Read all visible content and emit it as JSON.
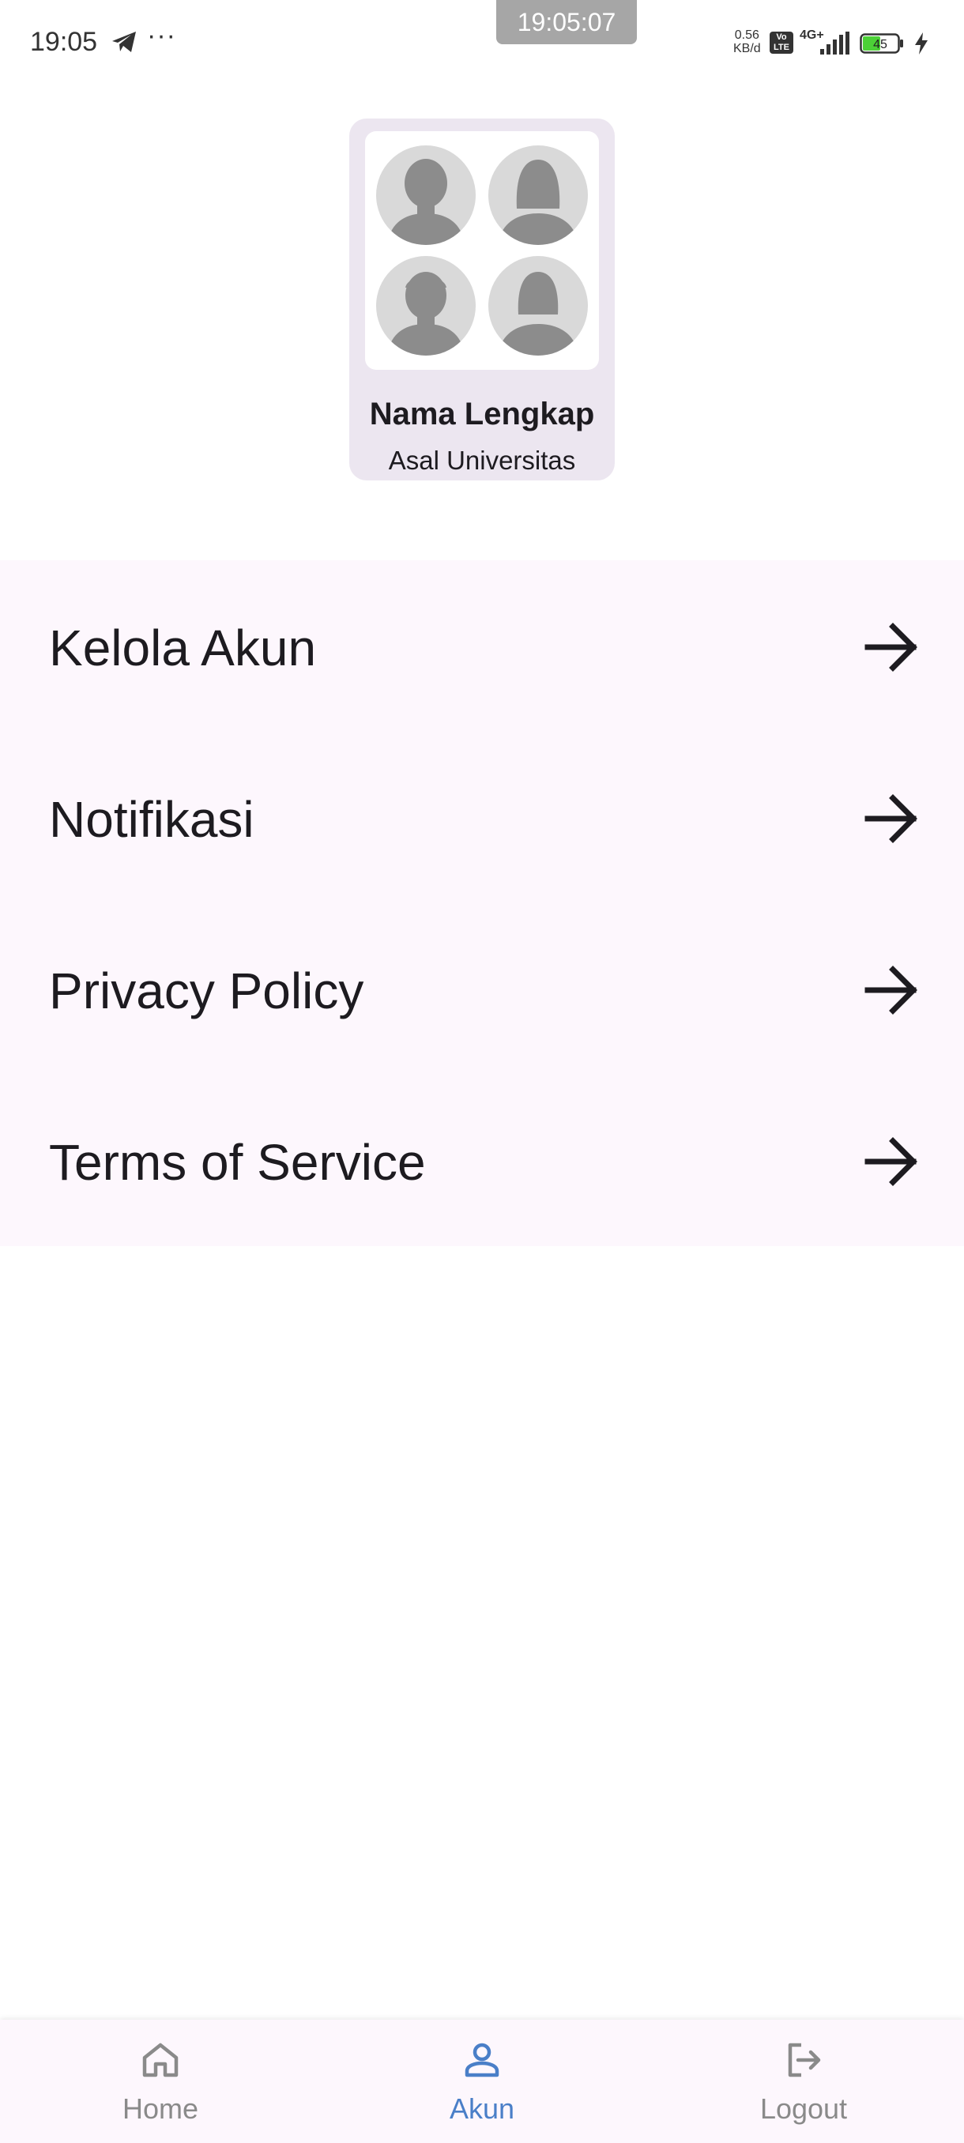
{
  "status_bar": {
    "time": "19:05",
    "dots": "···",
    "clock_overlay": "19:05:07",
    "speed_value": "0.56",
    "speed_unit": "KB/d",
    "volte_top": "Vo",
    "volte_bottom": "LTE",
    "network": "4G+",
    "battery": "45",
    "icons": [
      "telegram-icon",
      "signal-icon",
      "battery-icon",
      "charging-bolt-icon"
    ]
  },
  "profile": {
    "name": "Nama Lengkap",
    "university": "Asal Universitas",
    "avatar_icons": [
      "male-avatar-icon",
      "female-avatar-icon",
      "male-avatar-icon",
      "female-avatar-icon"
    ]
  },
  "menu": {
    "items": [
      {
        "label": "Kelola Akun",
        "icon": "arrow-right-icon"
      },
      {
        "label": "Notifikasi",
        "icon": "arrow-right-icon"
      },
      {
        "label": "Privacy Policy",
        "icon": "arrow-right-icon"
      },
      {
        "label": "Terms of Service",
        "icon": "arrow-right-icon"
      }
    ]
  },
  "bottom_nav": {
    "active": "Akun",
    "items": [
      {
        "label": "Home",
        "icon": "home-icon"
      },
      {
        "label": "Akun",
        "icon": "person-icon"
      },
      {
        "label": "Logout",
        "icon": "logout-icon"
      }
    ]
  },
  "colors": {
    "menu_background": "#fdf7fd",
    "card_background": "#ece6f0",
    "active_nav": "#4a7fc8",
    "inactive_nav": "#8a8a8a",
    "text": "#1d1b20"
  }
}
